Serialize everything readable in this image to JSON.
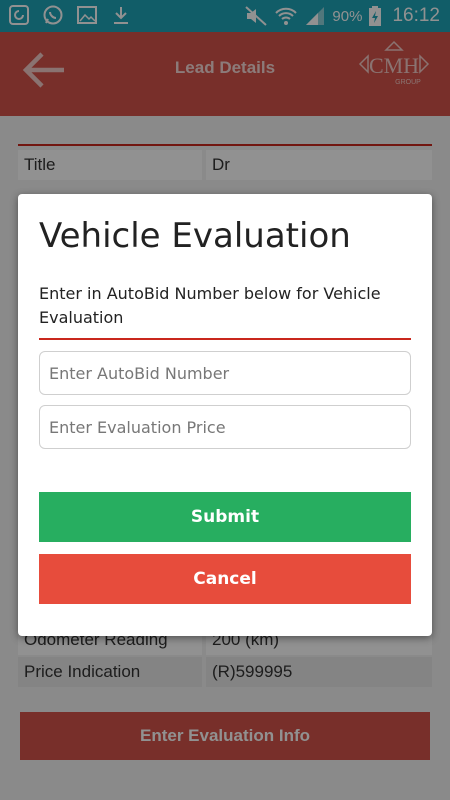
{
  "status_bar": {
    "battery": "90%",
    "time": "16:12"
  },
  "header": {
    "title": "Lead Details",
    "logo_text": "CMH",
    "logo_sub": "GROUP"
  },
  "details": {
    "rows": [
      {
        "label": "Title",
        "value": "Dr"
      },
      {
        "label": "Odometer Reading",
        "value": "200 (km)"
      },
      {
        "label": "Price Indication",
        "value": "(R)599995"
      }
    ]
  },
  "footer": {
    "button_label": "Enter Evaluation Info"
  },
  "dialog": {
    "title": "Vehicle Evaluation",
    "message": "Enter in AutoBid Number below for Vehicle Evaluation",
    "autobid_placeholder": "Enter AutoBid Number",
    "price_placeholder": "Enter Evaluation Price",
    "submit_label": "Submit",
    "cancel_label": "Cancel"
  },
  "colors": {
    "status_bar": "#1ea4b7",
    "header": "#d4544a",
    "accent_rule": "#c9271d",
    "submit": "#27ae60",
    "cancel": "#e74c3c"
  }
}
